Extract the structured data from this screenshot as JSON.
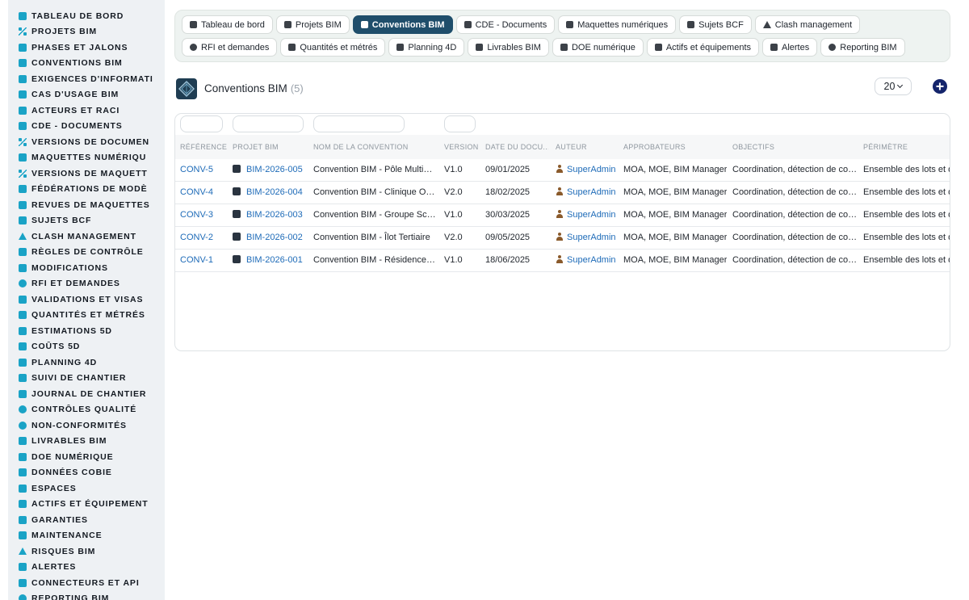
{
  "sidebar": {
    "items": [
      {
        "label": "TABLEAU DE BORD",
        "icon": "dashboard-icon"
      },
      {
        "label": "PROJETS BIM",
        "icon": "project-diagram-icon"
      },
      {
        "label": "PHASES ET JALONS",
        "icon": "layers-icon"
      },
      {
        "label": "CONVENTIONS BIM",
        "icon": "file-signature-icon"
      },
      {
        "label": "EXIGENCES D'INFORMATI",
        "icon": "clipboard-icon"
      },
      {
        "label": "CAS D'USAGE BIM",
        "icon": "file-icon"
      },
      {
        "label": "ACTEURS ET RACI",
        "icon": "users-icon"
      },
      {
        "label": "CDE - DOCUMENTS",
        "icon": "folder-icon"
      },
      {
        "label": "VERSIONS DE DOCUMEN",
        "icon": "code-branch-icon"
      },
      {
        "label": "MAQUETTES NUMÉRIQU",
        "icon": "cubes-icon"
      },
      {
        "label": "VERSIONS DE MAQUETT",
        "icon": "code-branch-icon"
      },
      {
        "label": "FÉDÉRATIONS DE MODÈ",
        "icon": "sitemap-icon"
      },
      {
        "label": "REVUES DE MAQUETTES",
        "icon": "search-icon"
      },
      {
        "label": "SUJETS BCF",
        "icon": "comments-icon"
      },
      {
        "label": "CLASH MANAGEMENT",
        "icon": "warning-icon"
      },
      {
        "label": "RÈGLES DE CONTRÔLE",
        "icon": "cogs-icon"
      },
      {
        "label": "MODIFICATIONS",
        "icon": "edit-icon"
      },
      {
        "label": "RFI ET DEMANDES",
        "icon": "question-circle-icon"
      },
      {
        "label": "VALIDATIONS ET VISAS",
        "icon": "check-double-icon"
      },
      {
        "label": "QUANTITÉS ET MÉTRÉS",
        "icon": "calculator-icon"
      },
      {
        "label": "ESTIMATIONS 5D",
        "icon": "coins-icon"
      },
      {
        "label": "COÛTS 5D",
        "icon": "money-bill-icon"
      },
      {
        "label": "PLANNING 4D",
        "icon": "calendar-icon"
      },
      {
        "label": "SUIVI DE CHANTIER",
        "icon": "hard-hat-icon"
      },
      {
        "label": "JOURNAL DE CHANTIER",
        "icon": "book-icon"
      },
      {
        "label": "CONTRÔLES QUALITÉ",
        "icon": "check-circle-icon"
      },
      {
        "label": "NON-CONFORMITÉS",
        "icon": "exclamation-circle-icon"
      },
      {
        "label": "LIVRABLES BIM",
        "icon": "box-icon"
      },
      {
        "label": "DOE NUMÉRIQUE",
        "icon": "book-open-icon"
      },
      {
        "label": "DONNÉES COBIE",
        "icon": "table-icon"
      },
      {
        "label": "ESPACES",
        "icon": "door-icon"
      },
      {
        "label": "ACTIFS ET ÉQUIPEMENT",
        "icon": "cogs-icon"
      },
      {
        "label": "GARANTIES",
        "icon": "shield-icon"
      },
      {
        "label": "MAINTENANCE",
        "icon": "wrench-icon"
      },
      {
        "label": "RISQUES BIM",
        "icon": "warning-icon"
      },
      {
        "label": "ALERTES",
        "icon": "bell-icon"
      },
      {
        "label": "CONNECTEURS ET API",
        "icon": "plug-icon"
      },
      {
        "label": "REPORTING BIM",
        "icon": "chart-pie-icon"
      }
    ]
  },
  "tabs": [
    {
      "label": "Tableau de bord",
      "icon": "dashboard-icon",
      "active": false
    },
    {
      "label": "Projets BIM",
      "icon": "project-diagram-icon",
      "active": false
    },
    {
      "label": "Conventions BIM",
      "icon": "file-signature-icon",
      "active": true
    },
    {
      "label": "CDE - Documents",
      "icon": "folder-icon",
      "active": false
    },
    {
      "label": "Maquettes numériques",
      "icon": "cubes-icon",
      "active": false
    },
    {
      "label": "Sujets BCF",
      "icon": "comments-icon",
      "active": false
    },
    {
      "label": "Clash management",
      "icon": "warning-icon",
      "active": false
    },
    {
      "label": "RFI et demandes",
      "icon": "question-circle-icon",
      "active": false
    },
    {
      "label": "Quantités et métrés",
      "icon": "calculator-icon",
      "active": false
    },
    {
      "label": "Planning 4D",
      "icon": "calendar-icon",
      "active": false
    },
    {
      "label": "Livrables BIM",
      "icon": "box-icon",
      "active": false
    },
    {
      "label": "DOE numérique",
      "icon": "book-open-icon",
      "active": false
    },
    {
      "label": "Actifs et équipements",
      "icon": "cogs-icon",
      "active": false
    },
    {
      "label": "Alertes",
      "icon": "bell-icon",
      "active": false
    },
    {
      "label": "Reporting BIM",
      "icon": "chart-pie-icon",
      "active": false
    }
  ],
  "header": {
    "title": "Conventions BIM",
    "count": "(5)",
    "page_size": "20"
  },
  "table": {
    "columns": [
      "RÉFÉRENCE",
      "PROJET BIM",
      "NOM DE LA CONVENTION",
      "VERSION",
      "DATE DU DOCU...",
      "AUTEUR",
      "APPROBATEURS",
      "OBJECTIFS",
      "PÉRIMÈTRE"
    ],
    "rows": [
      {
        "ref": "CONV-5",
        "project": "BIM-2026-005",
        "name": "Convention BIM - Pôle Multimédia",
        "version": "V1.0",
        "date": "09/01/2025",
        "author": "SuperAdmin",
        "approvers": "MOA, MOE, BIM Manager",
        "objectives": "Coordination, détection de conflits",
        "scope": "Ensemble des lots et disciplines"
      },
      {
        "ref": "CONV-4",
        "project": "BIM-2026-004",
        "name": "Convention BIM - Clinique Opale",
        "version": "V2.0",
        "date": "18/02/2025",
        "author": "SuperAdmin",
        "approvers": "MOA, MOE, BIM Manager",
        "objectives": "Coordination, détection de conflits",
        "scope": "Ensemble des lots et disciplines"
      },
      {
        "ref": "CONV-3",
        "project": "BIM-2026-003",
        "name": "Convention BIM - Groupe Scolaire",
        "version": "V1.0",
        "date": "30/03/2025",
        "author": "SuperAdmin",
        "approvers": "MOA, MOE, BIM Manager",
        "objectives": "Coordination, détection de conflits",
        "scope": "Ensemble des lots et disciplines"
      },
      {
        "ref": "CONV-2",
        "project": "BIM-2026-002",
        "name": "Convention BIM - Îlot Tertiaire",
        "version": "V2.0",
        "date": "09/05/2025",
        "author": "SuperAdmin",
        "approvers": "MOA, MOE, BIM Manager",
        "objectives": "Coordination, détection de conflits",
        "scope": "Ensemble des lots et disciplines"
      },
      {
        "ref": "CONV-1",
        "project": "BIM-2026-001",
        "name": "Convention BIM - Résidence Les Jardins",
        "version": "V1.0",
        "date": "18/06/2025",
        "author": "SuperAdmin",
        "approvers": "MOA, MOE, BIM Manager",
        "objectives": "Coordination, détection de conflits",
        "scope": "Ensemble des lots et disciplines"
      }
    ]
  },
  "colors": {
    "accent": "#1aa3c6",
    "active_tab": "#1f4e6b",
    "link": "#1e6bb8",
    "add_button": "#14246b"
  }
}
